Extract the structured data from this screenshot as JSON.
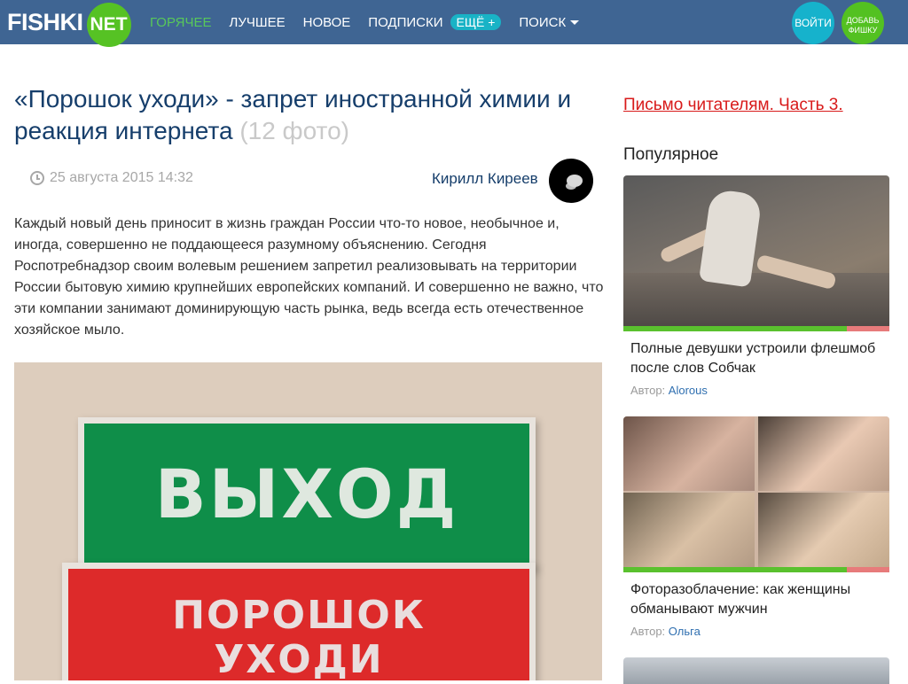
{
  "header": {
    "logo_text": "FISHKI",
    "logo_suffix": "NET",
    "nav": {
      "hot": "ГОРЯЧЕЕ",
      "best": "ЛУЧШЕЕ",
      "new": "НОВОЕ",
      "subscriptions": "ПОДПИСКИ",
      "more": "ЕЩЁ +",
      "search": "ПОИСК"
    },
    "login_label": "ВОЙТИ",
    "add_label_line1": "ДОБАВЬ",
    "add_label_line2": "ФИШКУ",
    "colors": {
      "bar": "#3f6593",
      "hot": "#58c85a",
      "login": "#16b2cc",
      "add": "#53c121"
    }
  },
  "article": {
    "title": "«Порошок уходи» - запрет иностранной химии и реакция интернета",
    "photo_count": "(12 фото)",
    "date": "25 августа 2015 14:32",
    "author": "Кирилл Киреев",
    "body": "Каждый новый день приносит в жизнь граждан России что-то новое, необычное и, иногда, совершенно не поддающееся разумному объяснению. Сегодня Роспотребнадзор своим волевым решением запретил реализовывать на территории России бытовую химию крупнейших европейских компаний. И совершенно не важно, что эти компании занимают доминирующую часть рынка, ведь всегда есть отечественное хозяйское мыло.",
    "image": {
      "sign_top": "ВЫХОД",
      "sign_bottom_line1": "ПОРОШОК",
      "sign_bottom_line2": "УХОДИ"
    }
  },
  "sidebar": {
    "letter_link": "Письмо читателям. Часть 3.",
    "popular_heading": "Популярное",
    "author_prefix": "Автор:",
    "cards": [
      {
        "title": "Полные девушки устроили флешмоб после слов Собчак",
        "author": "Alorous"
      },
      {
        "title": "Фоторазоблачение: как женщины обманывают мужчин",
        "author": "Ольга"
      }
    ]
  }
}
